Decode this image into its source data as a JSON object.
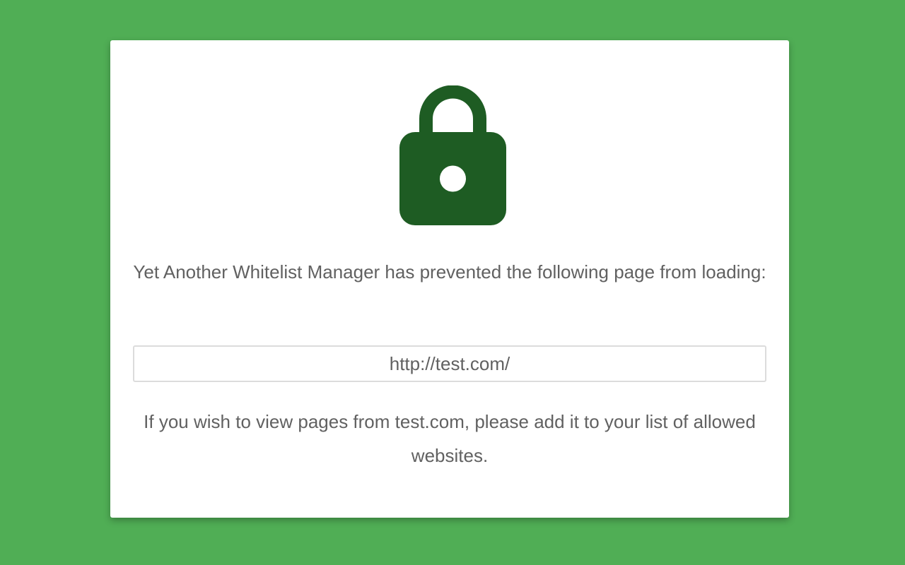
{
  "page": {
    "background_color": "#50ae55",
    "card_color": "#ffffff",
    "text_color": "#616161"
  },
  "icon": {
    "name": "lock-icon",
    "color": "#1e5c23"
  },
  "blocked": {
    "message": "Yet Another Whitelist Manager has prevented the following page from loading:",
    "url": "http://test.com/",
    "hint": "If you wish to view pages from test.com, please add it to your list of allowed websites."
  }
}
